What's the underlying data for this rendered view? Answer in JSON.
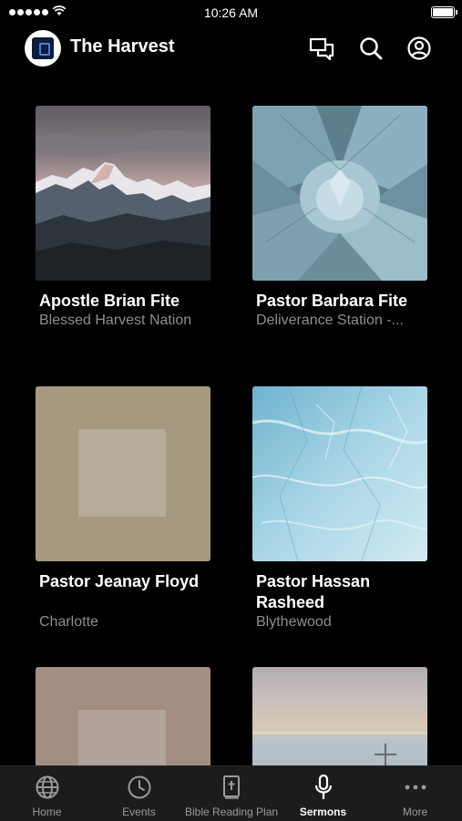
{
  "status_bar": {
    "time": "10:26 AM"
  },
  "header": {
    "app_title": "The Harvest"
  },
  "cards": [
    {
      "title": "Apostle Brian Fite",
      "subtitle": "Blessed Harvest Nation"
    },
    {
      "title": "Pastor Barbara Fite",
      "subtitle": "Deliverance Station -..."
    },
    {
      "title": "Pastor Jeanay Floyd",
      "subtitle": "Charlotte"
    },
    {
      "title": "Pastor Hassan Rasheed",
      "subtitle": "Blythewood"
    }
  ],
  "colors": {
    "background": "#000000",
    "tabbar": "#1c1c1c",
    "placeholder_tan": "#a59a7f",
    "placeholder_mauve": "#a38e83"
  },
  "tabs": [
    {
      "label": "Home",
      "icon": "globe-icon"
    },
    {
      "label": "Events",
      "icon": "clock-icon"
    },
    {
      "label": "Bible Reading Plan",
      "icon": "bible-icon"
    },
    {
      "label": "Sermons",
      "icon": "microphone-icon",
      "active": true
    },
    {
      "label": "More",
      "icon": "more-dots-icon"
    }
  ]
}
